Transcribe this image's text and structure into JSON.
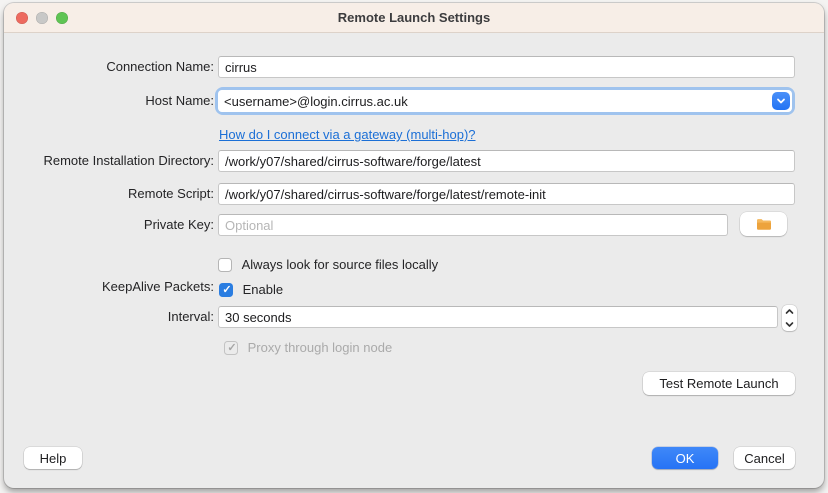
{
  "window": {
    "title": "Remote Launch Settings"
  },
  "form": {
    "connection_name": {
      "label": "Connection Name:",
      "value": "cirrus"
    },
    "host_name": {
      "label": "Host Name:",
      "value": "<username>@login.cirrus.ac.uk"
    },
    "gateway_link_text": "How do I connect via a gateway (multi-hop)?",
    "remote_installation_directory": {
      "label": "Remote Installation Directory:",
      "value": "/work/y07/shared/cirrus-software/forge/latest"
    },
    "remote_script": {
      "label": "Remote Script:",
      "value": "/work/y07/shared/cirrus-software/forge/latest/remote-init"
    },
    "private_key": {
      "label": "Private Key:",
      "placeholder": "Optional"
    },
    "source_files_checkbox": {
      "label": "Always look for source files locally",
      "checked": false
    },
    "keepalive_packets": {
      "label": "KeepAlive Packets:",
      "checkbox_label": "Enable",
      "checked": true
    },
    "interval": {
      "label": "Interval:",
      "value": "30 seconds"
    },
    "proxy_checkbox": {
      "label": "Proxy through login node",
      "checked": true,
      "disabled": true
    },
    "test_remote_launch_label": "Test Remote Launch"
  },
  "footer": {
    "help_label": "Help",
    "ok_label": "OK",
    "cancel_label": "Cancel"
  },
  "icons": {
    "combobox_button": "chevron-down-icon",
    "private_key_browse": "folder-icon",
    "interval_stepper_up": "chevron-up-icon",
    "interval_stepper_down": "chevron-down-icon"
  },
  "colors": {
    "accent_blue": "#2e7ef7",
    "link_blue": "#1b6fd6",
    "titlebar_bg": "#f7eee7",
    "body_bg": "#ebebeb",
    "traffic_close": "#ed6a5f",
    "traffic_minimize": "#c8c8c7",
    "traffic_zoom": "#5fc454",
    "folder_orange": "#eda33c"
  }
}
